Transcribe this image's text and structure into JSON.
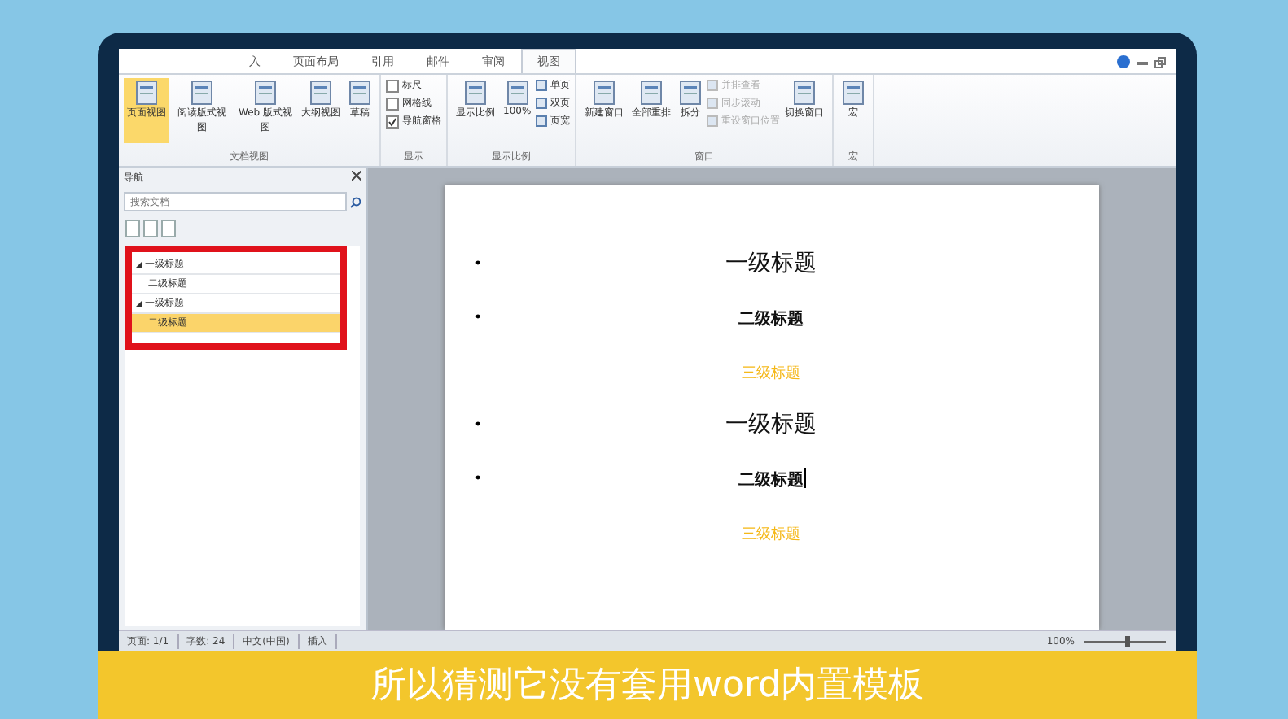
{
  "tabs": [
    {
      "label": "入",
      "selected": false
    },
    {
      "label": "页面布局",
      "selected": false
    },
    {
      "label": "引用",
      "selected": false
    },
    {
      "label": "邮件",
      "selected": false
    },
    {
      "label": "审阅",
      "selected": false
    },
    {
      "label": "视图",
      "selected": true
    }
  ],
  "ribbon_groups": [
    {
      "label": "文档视图",
      "items": [
        {
          "kind": "big",
          "label": "页面视图",
          "selected": true
        },
        {
          "kind": "big",
          "label": "阅读版式视图",
          "selected": false
        },
        {
          "kind": "big",
          "label": "Web 版式视图",
          "selected": false
        },
        {
          "kind": "big",
          "label": "大纲视图",
          "selected": false
        },
        {
          "kind": "big",
          "label": "草稿",
          "selected": false
        }
      ]
    },
    {
      "label": "显示",
      "items": [
        {
          "kind": "check",
          "label": "标尺",
          "checked": false
        },
        {
          "kind": "check",
          "label": "网格线",
          "checked": false
        },
        {
          "kind": "check",
          "label": "导航窗格",
          "checked": true
        }
      ]
    },
    {
      "label": "显示比例",
      "items": [
        {
          "kind": "big",
          "label": "显示比例",
          "selected": false
        },
        {
          "kind": "big",
          "label": "100%",
          "selected": false
        },
        {
          "kind": "small",
          "label": "单页",
          "disabled": false
        },
        {
          "kind": "small",
          "label": "双页",
          "disabled": false
        },
        {
          "kind": "small",
          "label": "页宽",
          "disabled": false
        }
      ]
    },
    {
      "label": "窗口",
      "items": [
        {
          "kind": "big",
          "label": "新建窗口",
          "selected": false
        },
        {
          "kind": "big",
          "label": "全部重排",
          "selected": false
        },
        {
          "kind": "big",
          "label": "拆分",
          "selected": false
        },
        {
          "kind": "small",
          "label": "并排查看",
          "disabled": true
        },
        {
          "kind": "small",
          "label": "同步滚动",
          "disabled": true
        },
        {
          "kind": "small",
          "label": "重设窗口位置",
          "disabled": true
        },
        {
          "kind": "big",
          "label": "切换窗口",
          "selected": false
        }
      ]
    },
    {
      "label": "宏",
      "items": [
        {
          "kind": "big",
          "label": "宏",
          "selected": false
        }
      ]
    }
  ],
  "nav_pane": {
    "title": "导航",
    "search": {
      "placeholder": "搜索文档"
    },
    "tree": [
      {
        "label": "一级标题",
        "expanded": true,
        "selected": false,
        "children": [
          {
            "label": "二级标题",
            "selected": false
          }
        ]
      },
      {
        "label": "一级标题",
        "expanded": true,
        "selected": false,
        "children": [
          {
            "label": "二级标题",
            "selected": true
          }
        ]
      }
    ]
  },
  "document": {
    "paragraphs": [
      {
        "kind": "h1",
        "text": "一级标题",
        "bullet": true,
        "cursor": false
      },
      {
        "kind": "h2",
        "text": "二级标题",
        "bullet": true,
        "cursor": false
      },
      {
        "kind": "h3",
        "text": "三级标题",
        "bullet": false,
        "cursor": false
      },
      {
        "kind": "h1",
        "text": "一级标题",
        "bullet": true,
        "cursor": false
      },
      {
        "kind": "h2",
        "text": "二级标题",
        "bullet": true,
        "cursor": true
      },
      {
        "kind": "h3",
        "text": "三级标题",
        "bullet": false,
        "cursor": false
      }
    ]
  },
  "status_bar": {
    "items": [
      "页面: 1/1",
      "字数: 24",
      "中文(中国)",
      "插入"
    ],
    "zoom": "100%",
    "zoom_slider": {
      "level": 0.5
    }
  },
  "subtitle": "所以猜测它没有套用word内置模板"
}
